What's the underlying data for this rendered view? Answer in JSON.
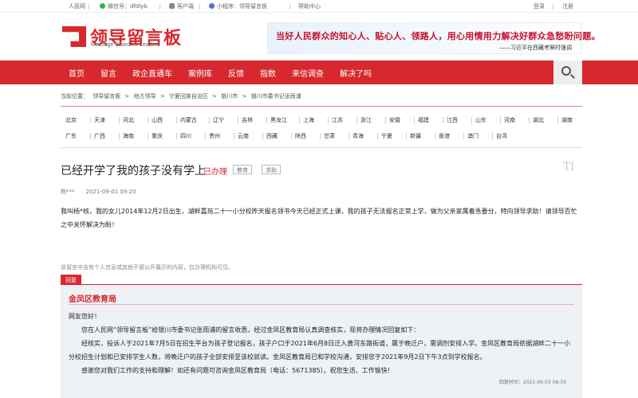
{
  "topbar": {
    "site": "人民网",
    "wechat": "微信号：dfdlyb",
    "client": "客户端",
    "mini": "小程序：领导留言板",
    "help": "帮助中心",
    "login": "登录",
    "register": "注册"
  },
  "logo": {
    "title": "领导留言板",
    "subtitle": "Message Board for Leaders"
  },
  "banner": {
    "slogan": "当好人民群众的知心人、贴心人、领路人，用心用情用力解决好群众急愁盼问题。",
    "attribution": "——习近平在西藏考察时强调"
  },
  "nav": [
    "首页",
    "留言",
    "政企直通车",
    "案例库",
    "反馈",
    "指数",
    "来信调查",
    "解决了吗"
  ],
  "breadcrumb": {
    "prefix": "当前位置：",
    "items": [
      "领导留言板",
      "地方领导",
      "宁夏回族自治区",
      "银川市",
      "银川市委书记张雨浦"
    ],
    "separator": ">"
  },
  "regions": {
    "row1": [
      "北京",
      "天津",
      "河北",
      "山西",
      "内蒙古",
      "辽宁",
      "吉林",
      "黑龙江",
      "上海",
      "江苏",
      "浙江",
      "安徽",
      "福建",
      "江西",
      "山东",
      "河南",
      "湖北",
      "湖南"
    ],
    "row2": [
      "广东",
      "广西",
      "海南",
      "重庆",
      "四川",
      "贵州",
      "云南",
      "西藏",
      "陕西",
      "甘肃",
      "青海",
      "宁夏",
      "新疆",
      "香港",
      "澳门",
      "台湾"
    ]
  },
  "post": {
    "title": "已经开学了我的孩子没有学上",
    "status": "已办理",
    "tags": [
      "教育",
      "求助"
    ],
    "deco": "Tl",
    "author": "杨***",
    "time": "2021-09-01 09:20",
    "body": "我叫杨*核，我的女儿2014年12月2日出生，湖畔嘉苑二十一小分校昨天报名领书今天已经正式上课，我的孩子无法报名正常上学，做为父亲家属着急要分，特向领导求助！请领导百忙之中关怀解决为盼！"
  },
  "disclaimer": "该留言中含有个人信息或其他不便公开展示的内容，仅办理机构可见。",
  "reply": {
    "tag": "回复",
    "org": "金凤区教育局",
    "greeting": "网友您好！",
    "p1": "您在人民网“领导留言板”给银川市委书记张雨浦的留言收悉，经过金凤区教育局认真调查核实，现将办理情况回复如下：",
    "p2": "经核实，投诉人于2021年7月5日在招生平台为孩子登记报名，孩子户口于2021年6月8日迁入黄河东路街道，属于晚迁户，需调剂安排入学。金凤区教育局依据湖畔二十一小分校招生计划和已安排学生人数，将晚迁户的孩子全部安排至该校就读。金凤区教育局已和学校沟通，安排您于2021年9月2日下午3点到学校报名。",
    "p3": "感谢您对我们工作的支持和理解！如还有问题可咨询金凤区教育局（电话：5671385）。祝您生活、工作愉快！",
    "time": "回复时间：2021-09-03 08:59"
  }
}
